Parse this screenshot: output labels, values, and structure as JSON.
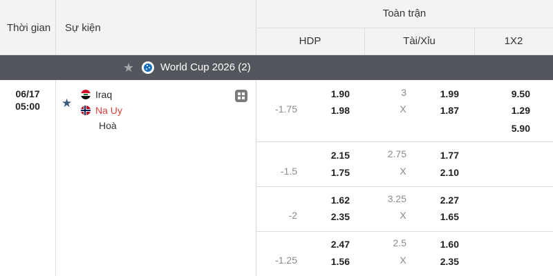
{
  "header": {
    "time_label": "Thời gian",
    "event_label": "Sự kiện",
    "fulltime_label": "Toàn trận",
    "hdp_label": "HDP",
    "ou_label": "Tài/Xỉu",
    "x12_label": "1X2"
  },
  "league": {
    "name": "World Cup 2026",
    "count": "(2)",
    "icon": "world-cup-logo-icon",
    "star_icon": "star-icon"
  },
  "match": {
    "date": "06/17",
    "time": "05:00",
    "home": "Iraq",
    "away": "Na Uy",
    "draw": "Hoà",
    "colors": {
      "away": "#e0403a",
      "fav_star": "#3a5a80"
    }
  },
  "odds_rows": [
    {
      "hdp_line": "-1.75",
      "hdp_home": "1.90",
      "hdp_away": "1.98",
      "ou_line": "3",
      "ou_x": "X",
      "ou_over": "1.99",
      "ou_under": "1.87",
      "x12_home": "9.50",
      "x12_away": "1.29",
      "x12_draw": "5.90"
    },
    {
      "hdp_line": "-1.5",
      "hdp_home": "2.15",
      "hdp_away": "1.75",
      "ou_line": "2.75",
      "ou_x": "X",
      "ou_over": "1.77",
      "ou_under": "2.10"
    },
    {
      "hdp_line": "-2",
      "hdp_home": "1.62",
      "hdp_away": "2.35",
      "ou_line": "3.25",
      "ou_x": "X",
      "ou_over": "2.27",
      "ou_under": "1.65"
    },
    {
      "hdp_line": "-1.25",
      "hdp_home": "2.47",
      "hdp_away": "1.56",
      "ou_line": "2.5",
      "ou_x": "X",
      "ou_over": "1.60",
      "ou_under": "2.35"
    }
  ]
}
